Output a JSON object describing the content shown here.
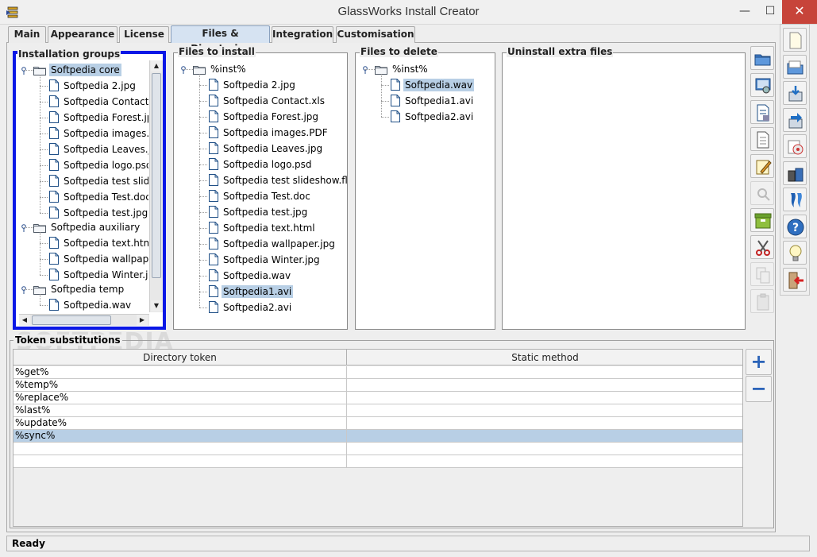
{
  "window": {
    "title": "GlassWorks Install Creator",
    "minimize_glyph": "—",
    "maximize_glyph": "☐",
    "close_glyph": "✕"
  },
  "tabs": [
    {
      "label": "Main",
      "active": false
    },
    {
      "label": "Appearance",
      "active": false
    },
    {
      "label": "License",
      "active": false
    },
    {
      "label": "Files & Directories",
      "active": true
    },
    {
      "label": "Integration",
      "active": false
    },
    {
      "label": "Customisation",
      "active": false
    }
  ],
  "installation_groups": {
    "title": "Installation groups",
    "groups": [
      {
        "name": "Softpedia core",
        "selected": true,
        "files": [
          "Softpedia 2.jpg",
          "Softpedia Contact.x",
          "Softpedia Forest.jp",
          "Softpedia images.P",
          "Softpedia Leaves.jp",
          "Softpedia logo.psd",
          "Softpedia test slide",
          "Softpedia Test.doc",
          "Softpedia test.jpg"
        ]
      },
      {
        "name": "Softpedia auxiliary",
        "selected": false,
        "files": [
          "Softpedia text.html",
          "Softpedia wallpape",
          "Softpedia Winter.jp"
        ]
      },
      {
        "name": "Softpedia temp",
        "selected": false,
        "files": [
          "Softpedia.wav"
        ]
      }
    ]
  },
  "files_to_install": {
    "title": "Files to install",
    "root": "%inst%",
    "files": [
      "Softpedia 2.jpg",
      "Softpedia Contact.xls",
      "Softpedia Forest.jpg",
      "Softpedia images.PDF",
      "Softpedia Leaves.jpg",
      "Softpedia logo.psd",
      "Softpedia test slideshow.flv",
      "Softpedia Test.doc",
      "Softpedia test.jpg",
      "Softpedia text.html",
      "Softpedia wallpaper.jpg",
      "Softpedia Winter.jpg",
      "Softpedia.wav",
      "Softpedia1.avi",
      "Softpedia2.avi"
    ],
    "selected_file": "Softpedia1.avi"
  },
  "files_to_delete": {
    "title": "Files to delete",
    "root": "%inst%",
    "files": [
      "Softpedia.wav",
      "Softpedia1.avi",
      "Softpedia2.avi"
    ],
    "selected_file": "Softpedia.wav"
  },
  "uninstall_extra": {
    "title": "Uninstall extra files"
  },
  "mid_toolbar": [
    {
      "icon": "open-folder-icon",
      "enabled": true
    },
    {
      "icon": "browse-disk-icon",
      "enabled": true
    },
    {
      "icon": "file-properties-icon",
      "enabled": true
    },
    {
      "icon": "blank-page-icon",
      "enabled": true
    },
    {
      "icon": "edit-note-icon",
      "enabled": true
    },
    {
      "icon": "zoom-icon",
      "enabled": false
    },
    {
      "icon": "archive-icon",
      "enabled": true
    },
    {
      "icon": "cut-icon",
      "enabled": true
    },
    {
      "icon": "copy-icon",
      "enabled": false
    },
    {
      "icon": "paste-icon",
      "enabled": false
    }
  ],
  "right_toolbar": [
    {
      "icon": "new-project-icon"
    },
    {
      "icon": "open-project-icon"
    },
    {
      "icon": "save-icon"
    },
    {
      "icon": "save-as-icon"
    },
    {
      "icon": "build-cd-icon"
    },
    {
      "icon": "package-icon"
    },
    {
      "icon": "test-install-icon"
    },
    {
      "icon": "help-icon"
    },
    {
      "icon": "tips-icon"
    },
    {
      "icon": "exit-icon"
    }
  ],
  "token_substitutions": {
    "title": "Token substitutions",
    "columns": [
      "Directory token",
      "Static method"
    ],
    "rows": [
      {
        "token": "%get%",
        "method": "",
        "selected": false
      },
      {
        "token": "%temp%",
        "method": "",
        "selected": false
      },
      {
        "token": "%replace%",
        "method": "",
        "selected": false
      },
      {
        "token": "%last%",
        "method": "",
        "selected": false
      },
      {
        "token": "%update%",
        "method": "",
        "selected": false
      },
      {
        "token": "%sync%",
        "method": "",
        "selected": true
      },
      {
        "token": "",
        "method": "",
        "selected": false
      },
      {
        "token": "",
        "method": "",
        "selected": false
      }
    ],
    "add_glyph": "+",
    "remove_glyph": "−"
  },
  "status": {
    "text": "Ready"
  },
  "watermark": "SOFTPEDIA",
  "colors": {
    "selection": "#b8cfe5",
    "focus_border": "#0a17e6",
    "close_button": "#c7443a"
  }
}
